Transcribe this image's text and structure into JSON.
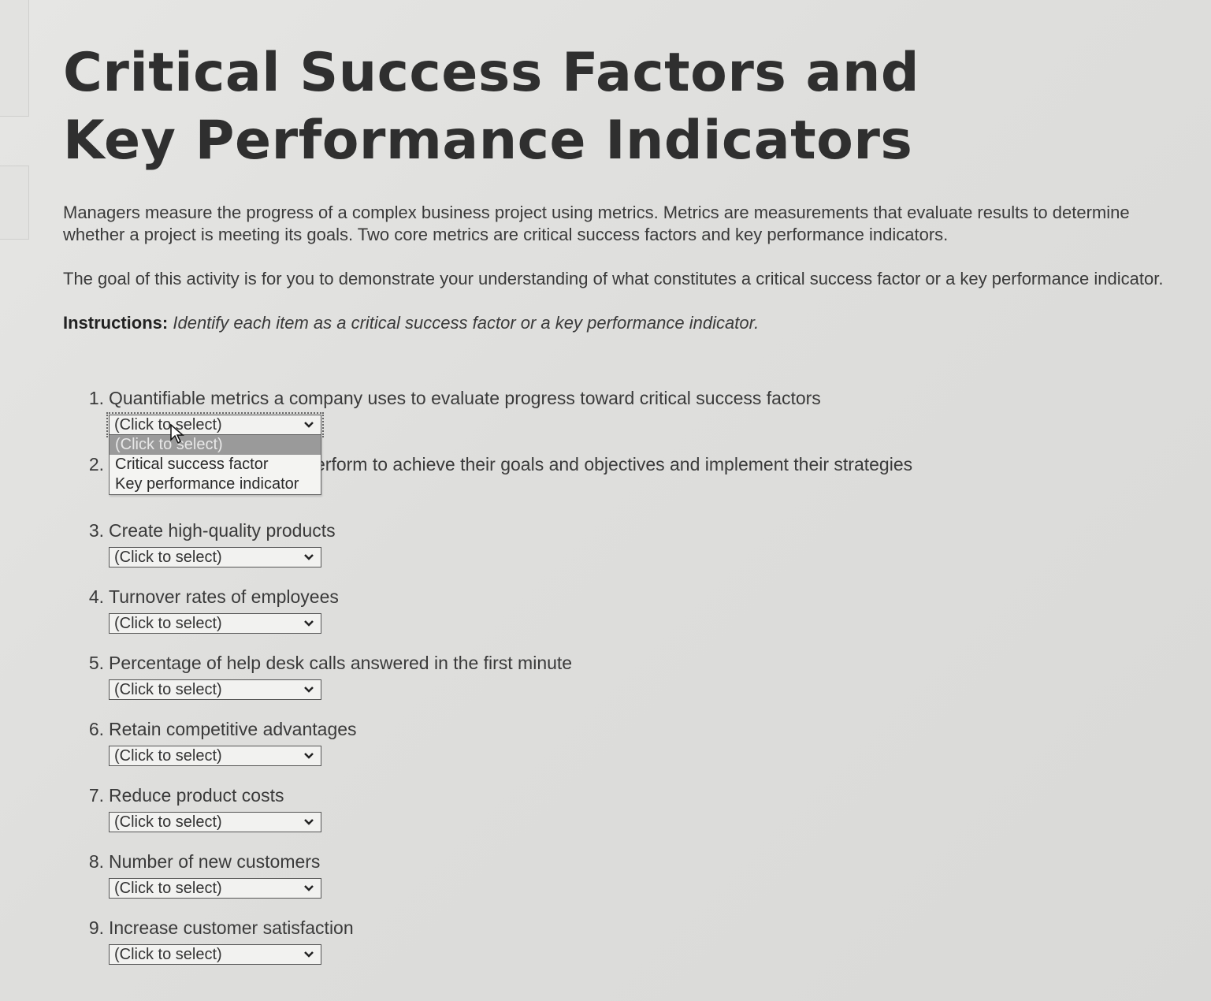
{
  "title": "Critical Success Factors and Key Performance Indicators",
  "intro": [
    "Managers measure the progress of a complex business project using metrics. Metrics are measurements that evaluate results to determine whether a project is meeting its goals. Two core metrics are critical success factors and key performance indicators.",
    "The goal of this activity is for you to demonstrate your understanding of what constitutes a critical success factor or a key performance indicator."
  ],
  "instructions": {
    "label": "Instructions:",
    "text": "Identify each item as a critical success factor or a key performance indicator."
  },
  "select_placeholder": "(Click to select)",
  "dropdown_options": [
    "(Click to select)",
    "Critical success factor",
    "Key performance indicator"
  ],
  "questions": [
    {
      "num": "1.",
      "text": "Quantifiable metrics a company uses to evaluate progress toward critical success factors"
    },
    {
      "num": "2.",
      "text": "erform to achieve their goals and objectives and implement their strategies"
    },
    {
      "num": "3.",
      "text": "Create high-quality products"
    },
    {
      "num": "4.",
      "text": "Turnover rates of employees"
    },
    {
      "num": "5.",
      "text": "Percentage of help desk calls answered in the first minute"
    },
    {
      "num": "6.",
      "text": "Retain competitive advantages"
    },
    {
      "num": "7.",
      "text": "Reduce product costs"
    },
    {
      "num": "8.",
      "text": "Number of new customers"
    },
    {
      "num": "9.",
      "text": "Increase customer satisfaction"
    }
  ],
  "icons": {
    "chevron": "chevron-down-icon",
    "cursor": "mouse-pointer-icon"
  }
}
